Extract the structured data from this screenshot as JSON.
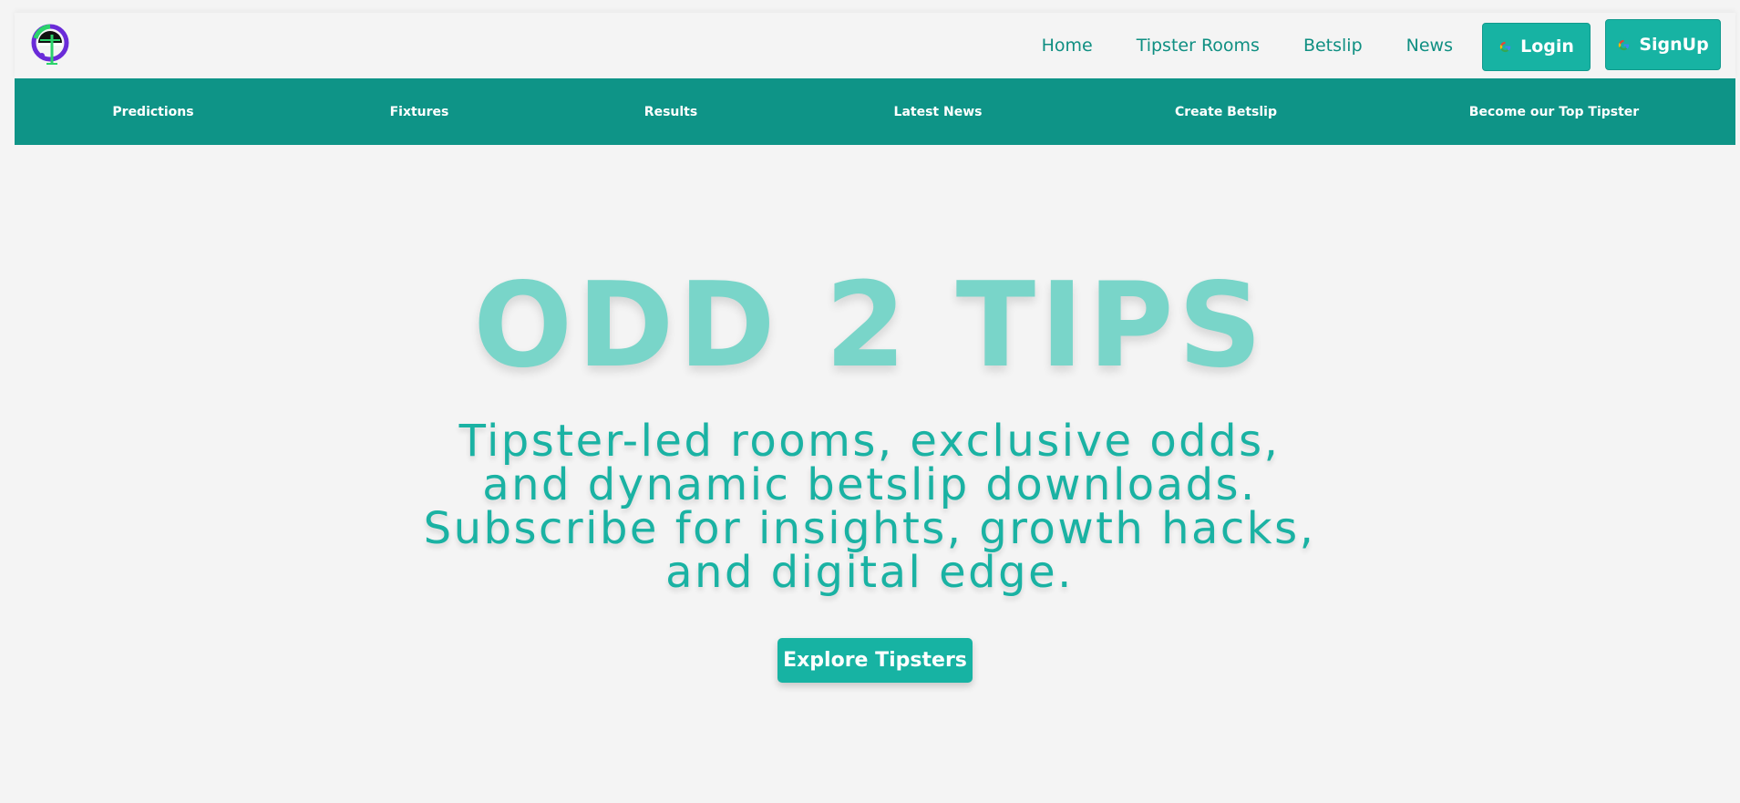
{
  "header": {
    "logo_icon": "brand-logo",
    "nav": {
      "home": "Home",
      "tipster_rooms": "Tipster Rooms",
      "betslip": "Betslip",
      "news": "News"
    },
    "login_label": "Login",
    "signup_label": "SignUp",
    "auth_icon": "google-icon"
  },
  "subnav": {
    "items": [
      "Predictions",
      "Fixtures",
      "Results",
      "Latest News",
      "Create Betslip",
      "Become our Top Tipster"
    ]
  },
  "hero": {
    "title": "ODD 2 TIPS",
    "subtitle": "Tipster-led rooms, exclusive odds, and dynamic betslip downloads. Subscribe for insights, growth hacks, and digital edge.",
    "cta_label": "Explore Tipsters"
  },
  "colors": {
    "primary": "#17b3a3",
    "nav_bar": "#0e9487",
    "title": "#79d5c9",
    "background": "#f4f4f4"
  }
}
